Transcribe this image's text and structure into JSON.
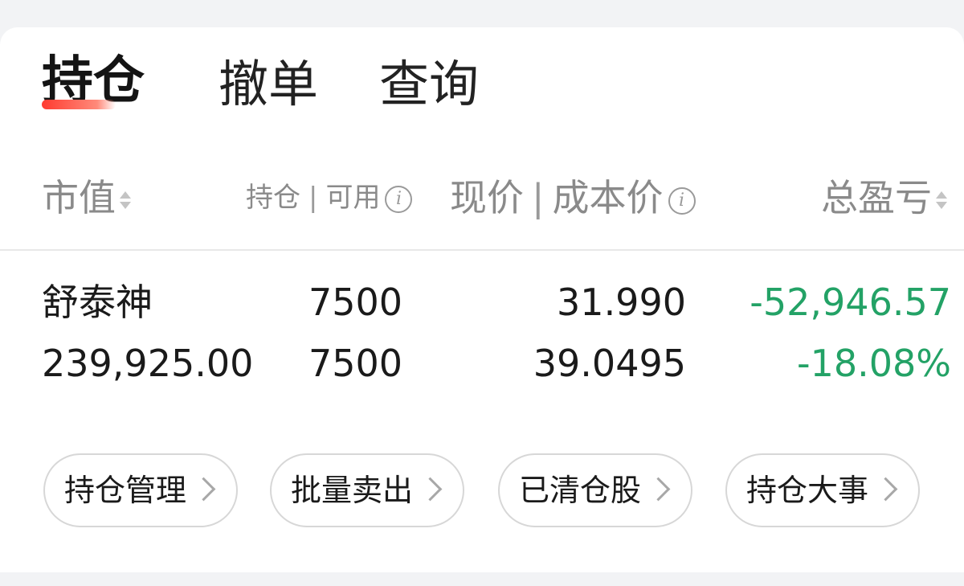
{
  "tabs": [
    {
      "label": "持仓",
      "active": true
    },
    {
      "label": "撤单",
      "active": false
    },
    {
      "label": "查询",
      "active": false
    }
  ],
  "header": {
    "market_value": "市值",
    "position": "持仓",
    "available": "可用",
    "current_price": "现价",
    "cost_price": "成本价",
    "total_pnl": "总盈亏"
  },
  "holdings": [
    {
      "name": "舒泰神",
      "market_value": "239,925.00",
      "position": "7500",
      "available": "7500",
      "current_price": "31.990",
      "cost_price": "39.0495",
      "pnl_amount": "-52,946.57",
      "pnl_percent": "-18.08%"
    }
  ],
  "actions": [
    {
      "label": "持仓管理"
    },
    {
      "label": "批量卖出"
    },
    {
      "label": "已清仓股"
    },
    {
      "label": "持仓大事"
    }
  ],
  "colors": {
    "loss": "#23a266",
    "accent": "#ff3b30"
  },
  "icons": {
    "sort": "sort-icon",
    "info": "info-icon",
    "chevron": "chevron-right-icon"
  }
}
